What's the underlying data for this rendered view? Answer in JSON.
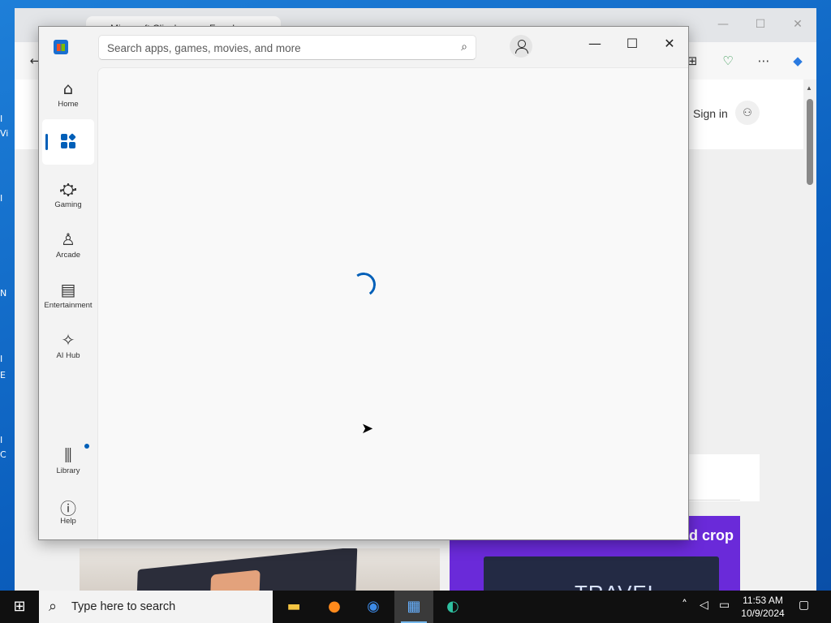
{
  "desktop": {
    "icon_letters": [
      "I",
      "Vi",
      "I",
      "N",
      "I",
      "E",
      "I",
      "C"
    ]
  },
  "browser": {
    "tab_title": "Microsoft Clipchamp – Free Ima",
    "signin_label": "Sign in",
    "promo_right_text": "d crop",
    "promo_travel_text": "TRAVEL"
  },
  "store": {
    "search_placeholder": "Search apps, games, movies, and more",
    "nav": {
      "home": "Home",
      "gaming": "Gaming",
      "arcade": "Arcade",
      "entertainment": "Entertainment",
      "ai_hub": "AI Hub",
      "library": "Library",
      "help": "Help"
    },
    "status": "loading"
  },
  "taskbar": {
    "search_text": "Type here to search",
    "time": "11:53 AM",
    "date": "10/9/2024",
    "apps": [
      "file-explorer",
      "firefox",
      "chrome",
      "microsoft-store",
      "edge"
    ]
  },
  "colors": {
    "accent": "#005fb8",
    "taskbar": "#101010",
    "desktop": "#0b5fbe"
  }
}
